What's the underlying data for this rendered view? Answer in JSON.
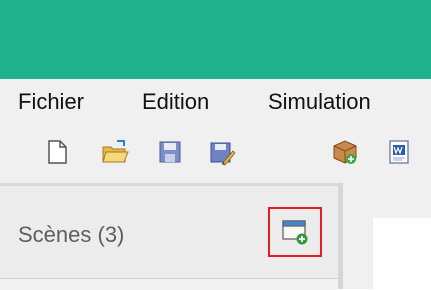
{
  "menu": {
    "items": [
      "Fichier",
      "Edition",
      "Simulation"
    ]
  },
  "toolbar": {
    "buttons": [
      "new-document-icon",
      "open-folder-icon",
      "save-icon",
      "save-as-icon",
      "package-export-icon",
      "word-document-icon"
    ]
  },
  "scenes_panel": {
    "title": "Scènes (3)",
    "add_button_icon": "add-scene-icon"
  },
  "colors": {
    "titlebar": "#1fb08c",
    "highlight": "#e02020"
  }
}
